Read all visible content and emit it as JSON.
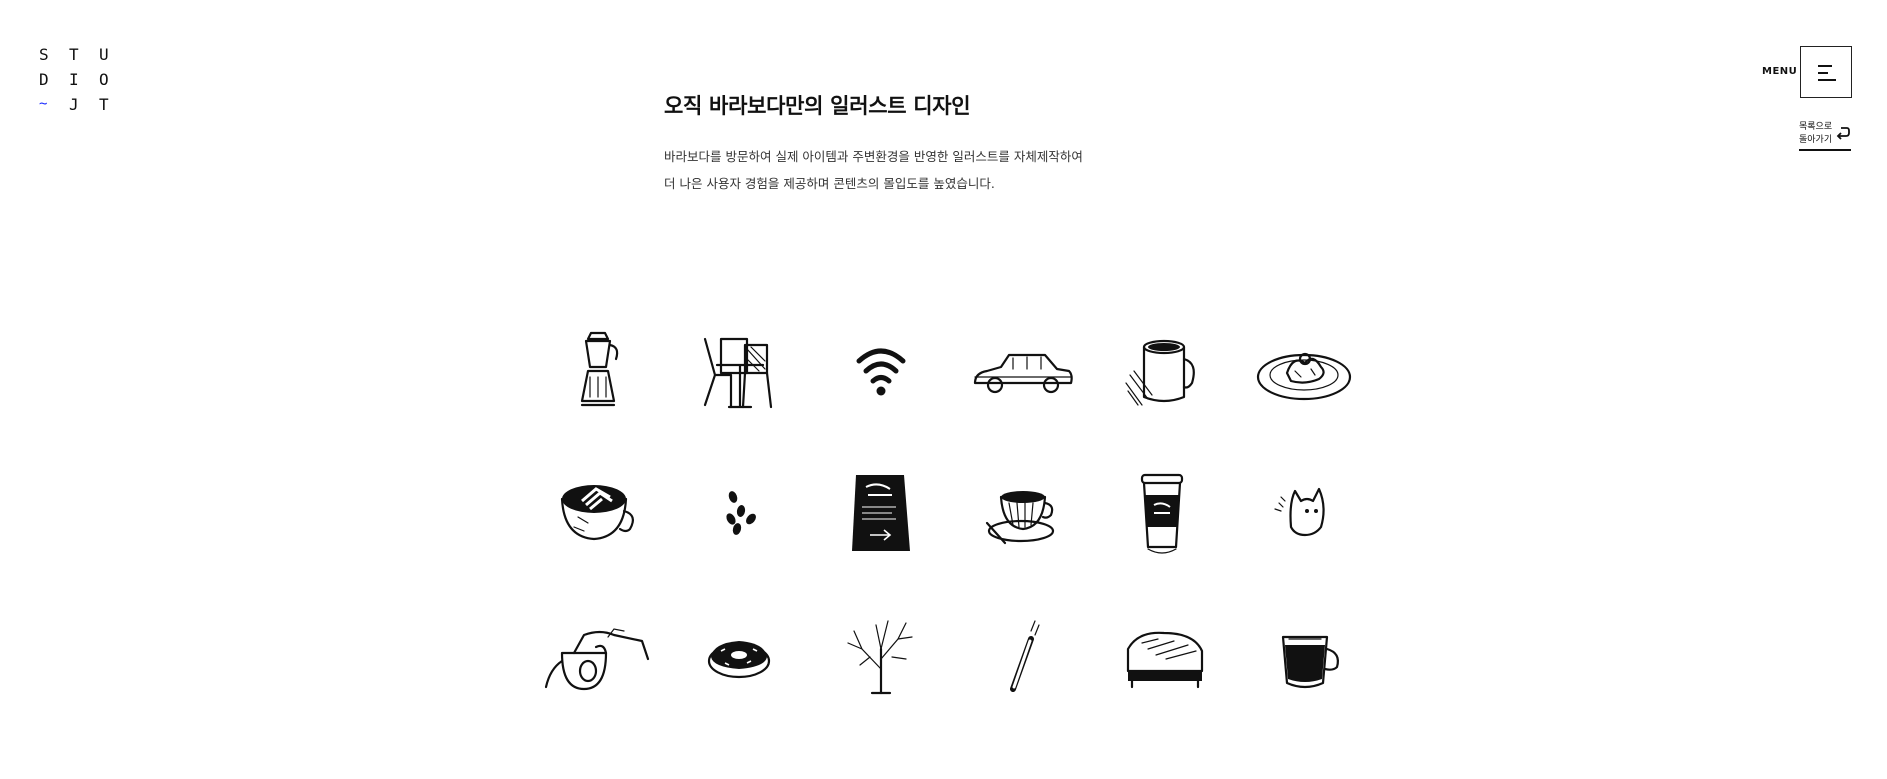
{
  "logo": {
    "letters": [
      "S",
      "T",
      "U",
      "D",
      "I",
      "O",
      "~",
      "J",
      "T"
    ]
  },
  "header": {
    "menu_label": "MENU",
    "menu_icon": "hamburger-icon",
    "back_label": "목록으로\n돌아가기",
    "back_icon": "return-arrow-icon"
  },
  "content": {
    "title": "오직 바라보다만의 일러스트 디자인",
    "desc_line1": "바라보다를 방문하여 실제 아이템과 주변환경을 반영한 일러스트를 자체제작하여",
    "desc_line2": "더 나은 사용자 경험을 제공하며 콘텐츠의 몰입도를 높였습니다."
  },
  "illustrations": [
    "moka-pot-icon",
    "cafe-chairs-table-icon",
    "wifi-icon",
    "car-icon",
    "mug-icon",
    "dessert-plate-icon",
    "latte-art-icon",
    "coffee-beans-icon",
    "menu-board-icon",
    "teacup-saucer-icon",
    "takeaway-cup-icon",
    "cat-icon",
    "drip-kettle-pour-icon",
    "donut-icon",
    "bare-tree-icon",
    "cigarette-icon",
    "toast-press-icon",
    "espresso-glass-icon"
  ],
  "colors": {
    "accent": "#1a2bff",
    "text": "#111111",
    "background": "#ffffff"
  }
}
